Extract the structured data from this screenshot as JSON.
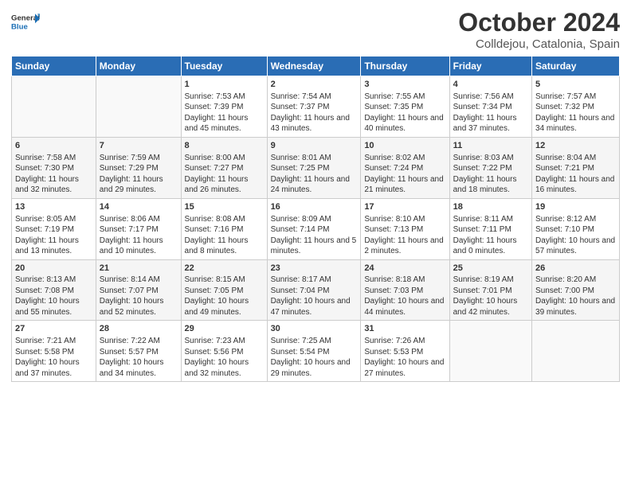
{
  "logo": {
    "line1": "General",
    "line2": "Blue"
  },
  "title": "October 2024",
  "subtitle": "Colldejou, Catalonia, Spain",
  "headers": [
    "Sunday",
    "Monday",
    "Tuesday",
    "Wednesday",
    "Thursday",
    "Friday",
    "Saturday"
  ],
  "weeks": [
    [
      {
        "day": "",
        "content": ""
      },
      {
        "day": "",
        "content": ""
      },
      {
        "day": "1",
        "content": "Sunrise: 7:53 AM\nSunset: 7:39 PM\nDaylight: 11 hours and 45 minutes."
      },
      {
        "day": "2",
        "content": "Sunrise: 7:54 AM\nSunset: 7:37 PM\nDaylight: 11 hours and 43 minutes."
      },
      {
        "day": "3",
        "content": "Sunrise: 7:55 AM\nSunset: 7:35 PM\nDaylight: 11 hours and 40 minutes."
      },
      {
        "day": "4",
        "content": "Sunrise: 7:56 AM\nSunset: 7:34 PM\nDaylight: 11 hours and 37 minutes."
      },
      {
        "day": "5",
        "content": "Sunrise: 7:57 AM\nSunset: 7:32 PM\nDaylight: 11 hours and 34 minutes."
      }
    ],
    [
      {
        "day": "6",
        "content": "Sunrise: 7:58 AM\nSunset: 7:30 PM\nDaylight: 11 hours and 32 minutes."
      },
      {
        "day": "7",
        "content": "Sunrise: 7:59 AM\nSunset: 7:29 PM\nDaylight: 11 hours and 29 minutes."
      },
      {
        "day": "8",
        "content": "Sunrise: 8:00 AM\nSunset: 7:27 PM\nDaylight: 11 hours and 26 minutes."
      },
      {
        "day": "9",
        "content": "Sunrise: 8:01 AM\nSunset: 7:25 PM\nDaylight: 11 hours and 24 minutes."
      },
      {
        "day": "10",
        "content": "Sunrise: 8:02 AM\nSunset: 7:24 PM\nDaylight: 11 hours and 21 minutes."
      },
      {
        "day": "11",
        "content": "Sunrise: 8:03 AM\nSunset: 7:22 PM\nDaylight: 11 hours and 18 minutes."
      },
      {
        "day": "12",
        "content": "Sunrise: 8:04 AM\nSunset: 7:21 PM\nDaylight: 11 hours and 16 minutes."
      }
    ],
    [
      {
        "day": "13",
        "content": "Sunrise: 8:05 AM\nSunset: 7:19 PM\nDaylight: 11 hours and 13 minutes."
      },
      {
        "day": "14",
        "content": "Sunrise: 8:06 AM\nSunset: 7:17 PM\nDaylight: 11 hours and 10 minutes."
      },
      {
        "day": "15",
        "content": "Sunrise: 8:08 AM\nSunset: 7:16 PM\nDaylight: 11 hours and 8 minutes."
      },
      {
        "day": "16",
        "content": "Sunrise: 8:09 AM\nSunset: 7:14 PM\nDaylight: 11 hours and 5 minutes."
      },
      {
        "day": "17",
        "content": "Sunrise: 8:10 AM\nSunset: 7:13 PM\nDaylight: 11 hours and 2 minutes."
      },
      {
        "day": "18",
        "content": "Sunrise: 8:11 AM\nSunset: 7:11 PM\nDaylight: 11 hours and 0 minutes."
      },
      {
        "day": "19",
        "content": "Sunrise: 8:12 AM\nSunset: 7:10 PM\nDaylight: 10 hours and 57 minutes."
      }
    ],
    [
      {
        "day": "20",
        "content": "Sunrise: 8:13 AM\nSunset: 7:08 PM\nDaylight: 10 hours and 55 minutes."
      },
      {
        "day": "21",
        "content": "Sunrise: 8:14 AM\nSunset: 7:07 PM\nDaylight: 10 hours and 52 minutes."
      },
      {
        "day": "22",
        "content": "Sunrise: 8:15 AM\nSunset: 7:05 PM\nDaylight: 10 hours and 49 minutes."
      },
      {
        "day": "23",
        "content": "Sunrise: 8:17 AM\nSunset: 7:04 PM\nDaylight: 10 hours and 47 minutes."
      },
      {
        "day": "24",
        "content": "Sunrise: 8:18 AM\nSunset: 7:03 PM\nDaylight: 10 hours and 44 minutes."
      },
      {
        "day": "25",
        "content": "Sunrise: 8:19 AM\nSunset: 7:01 PM\nDaylight: 10 hours and 42 minutes."
      },
      {
        "day": "26",
        "content": "Sunrise: 8:20 AM\nSunset: 7:00 PM\nDaylight: 10 hours and 39 minutes."
      }
    ],
    [
      {
        "day": "27",
        "content": "Sunrise: 7:21 AM\nSunset: 5:58 PM\nDaylight: 10 hours and 37 minutes."
      },
      {
        "day": "28",
        "content": "Sunrise: 7:22 AM\nSunset: 5:57 PM\nDaylight: 10 hours and 34 minutes."
      },
      {
        "day": "29",
        "content": "Sunrise: 7:23 AM\nSunset: 5:56 PM\nDaylight: 10 hours and 32 minutes."
      },
      {
        "day": "30",
        "content": "Sunrise: 7:25 AM\nSunset: 5:54 PM\nDaylight: 10 hours and 29 minutes."
      },
      {
        "day": "31",
        "content": "Sunrise: 7:26 AM\nSunset: 5:53 PM\nDaylight: 10 hours and 27 minutes."
      },
      {
        "day": "",
        "content": ""
      },
      {
        "day": "",
        "content": ""
      }
    ]
  ]
}
